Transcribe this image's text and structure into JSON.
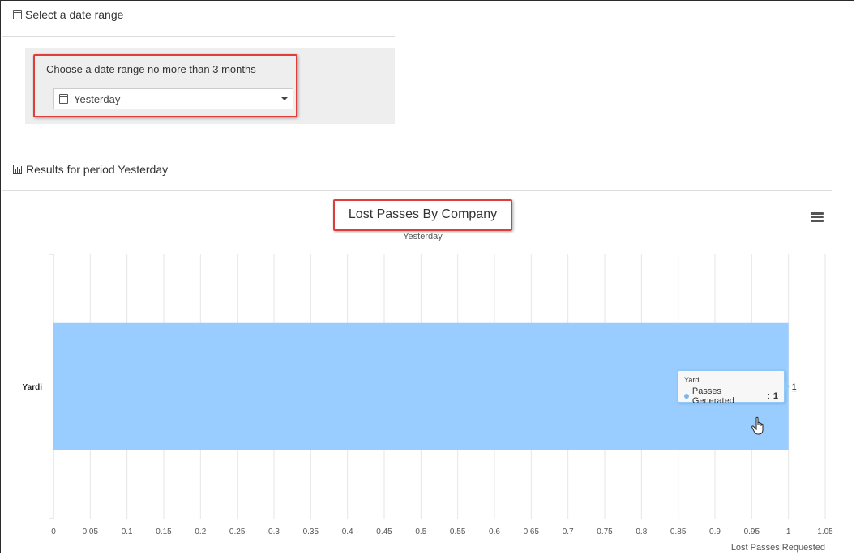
{
  "date_section": {
    "title": "Select a date range",
    "prompt": "Choose a date range no more than 3 months",
    "select_value": "Yesterday"
  },
  "results_section": {
    "title": "Results for period Yesterday"
  },
  "colors": {
    "highlight": "#e03c3c",
    "bar": "#99ccff",
    "tooltip_border": "#90c8f8",
    "series_dot": "#7cb5ec"
  },
  "tooltip": {
    "category": "Yardi",
    "series": "Passes Generated",
    "value_text": "1"
  },
  "icons": {
    "date_icon": "calendar-icon",
    "results_icon": "bar-chart-icon",
    "menu_icon": "hamburger-menu-icon",
    "cursor_icon": "hand-pointer-icon"
  },
  "chart_data": {
    "type": "bar",
    "orientation": "horizontal",
    "title": "Lost Passes By Company",
    "subtitle": "Yesterday",
    "categories": [
      "Yardi"
    ],
    "series": [
      {
        "name": "Passes Generated",
        "values": [
          1
        ]
      }
    ],
    "data_labels": [
      "1"
    ],
    "xlabel": "Lost Passes Requested",
    "ylabel": "",
    "xlim": [
      0,
      1.05
    ],
    "xticks": [
      "0",
      "0.05",
      "0.1",
      "0.15",
      "0.2",
      "0.25",
      "0.3",
      "0.35",
      "0.4",
      "0.45",
      "0.5",
      "0.55",
      "0.6",
      "0.65",
      "0.7",
      "0.75",
      "0.8",
      "0.85",
      "0.9",
      "0.95",
      "1",
      "1.05"
    ],
    "grid": true,
    "legend": "none"
  }
}
